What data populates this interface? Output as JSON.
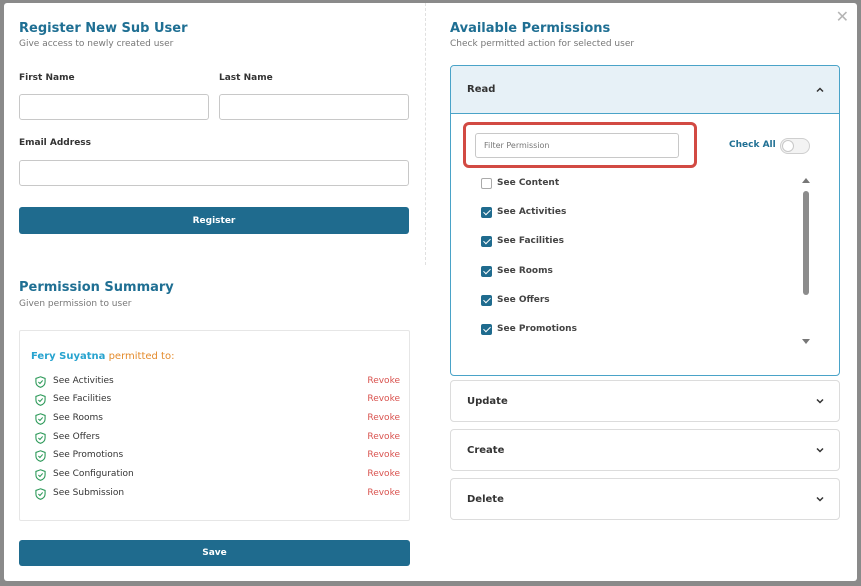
{
  "register": {
    "title": "Register New Sub User",
    "subtitle": "Give access to newly created user",
    "first_name_label": "First Name",
    "last_name_label": "Last Name",
    "email_label": "Email Address",
    "first_name_value": "",
    "last_name_value": "",
    "email_value": "",
    "register_label": "Register"
  },
  "summary": {
    "title": "Permission Summary",
    "subtitle": "Given permission to user",
    "user_name": "Fery Suyatna",
    "permitted_text": "permitted to:",
    "revoke_label": "Revoke",
    "items": [
      "See Activities",
      "See Facilities",
      "See Rooms",
      "See Offers",
      "See Promotions",
      "See Configuration",
      "See Submission"
    ],
    "save_label": "Save"
  },
  "permissions": {
    "title": "Available Permissions",
    "subtitle": "Check permitted action for selected user",
    "sections": [
      "Read",
      "Update",
      "Create",
      "Delete"
    ],
    "filter_placeholder": "Filter Permission",
    "check_all_label": "Check All",
    "check_all_on": false,
    "read_items": [
      {
        "label": "See Content",
        "checked": false
      },
      {
        "label": "See Activities",
        "checked": true
      },
      {
        "label": "See Facilities",
        "checked": true
      },
      {
        "label": "See Rooms",
        "checked": true
      },
      {
        "label": "See Offers",
        "checked": true
      },
      {
        "label": "See Promotions",
        "checked": true
      }
    ]
  },
  "colors": {
    "primary": "#1f6b8e",
    "title": "#1f6f93",
    "revoke": "#d9534f",
    "highlight": "#d24a43",
    "shield": "#2e9a5a"
  },
  "icons": {
    "close": "close-icon",
    "shield": "shield-check-icon",
    "chevron_up": "chevron-up-icon",
    "chevron_down": "chevron-down-icon"
  }
}
